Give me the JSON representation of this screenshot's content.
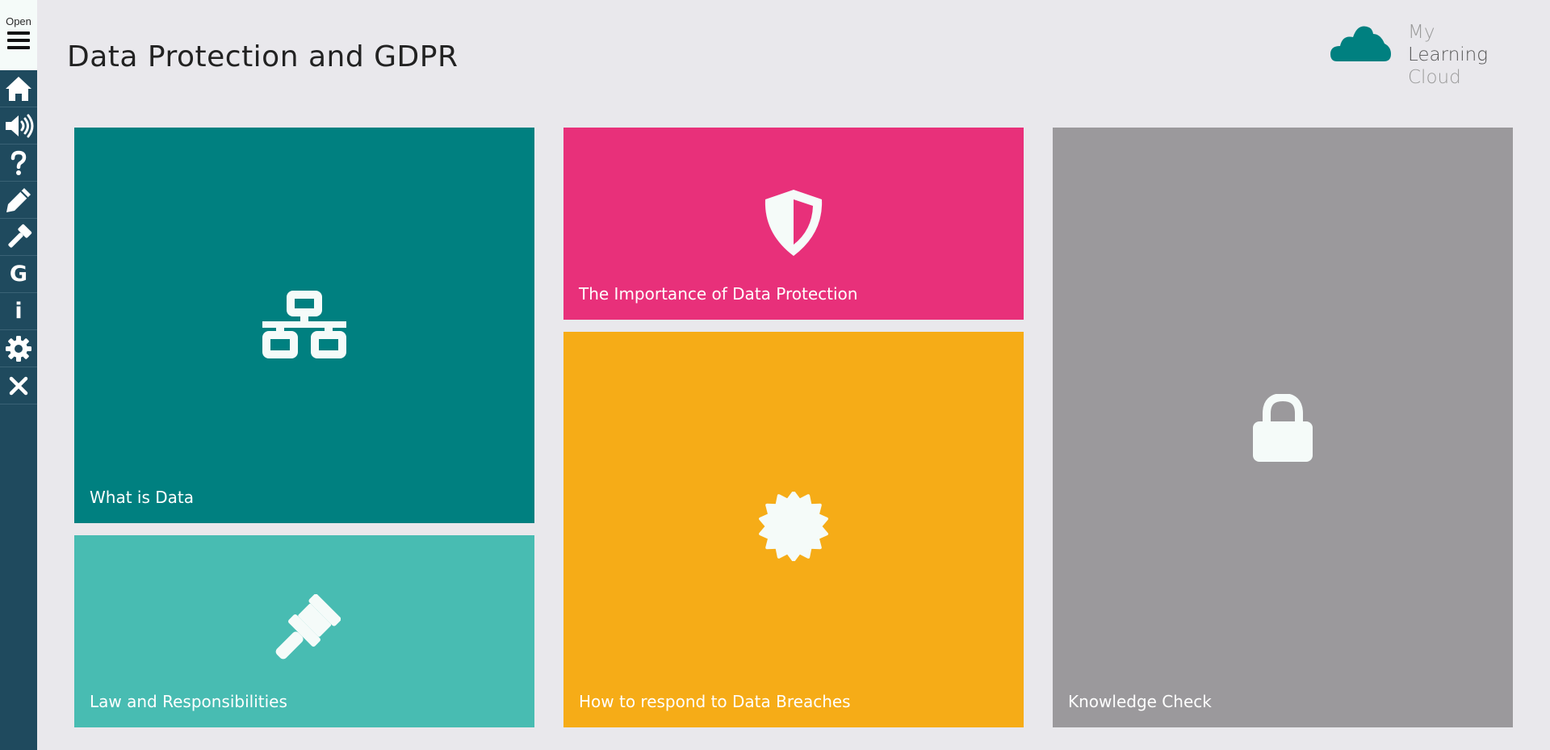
{
  "sidebar": {
    "open_label": "Open",
    "items": [
      {
        "icon": "home-icon",
        "label": ""
      },
      {
        "icon": "audio-icon",
        "label": ""
      },
      {
        "icon": "help-icon",
        "label": ""
      },
      {
        "icon": "pencil-icon",
        "label": ""
      },
      {
        "icon": "gavel-icon",
        "label": ""
      },
      {
        "icon": "glossary-icon",
        "label": "G"
      },
      {
        "icon": "info-icon",
        "label": "i"
      },
      {
        "icon": "settings-icon",
        "label": ""
      },
      {
        "icon": "close-icon",
        "label": ""
      }
    ]
  },
  "header": {
    "title": "Data Protection and GDPR"
  },
  "brand": {
    "word1": "My",
    "word2": "Learning",
    "word3": "Cloud",
    "color": "#008080"
  },
  "tiles": [
    {
      "label": "What is Data",
      "icon": "network-icon",
      "color": "#008080"
    },
    {
      "label": "Law and Responsibilities",
      "icon": "gavel-icon",
      "color": "#48bcb2"
    },
    {
      "label": "The Importance of Data Protection",
      "icon": "shield-icon",
      "color": "#e8307a"
    },
    {
      "label": "How to respond to Data Breaches",
      "icon": "certificate-icon",
      "color": "#f6ac17"
    },
    {
      "label": "Knowledge Check",
      "icon": "lock-icon",
      "color": "#9b999c"
    }
  ]
}
